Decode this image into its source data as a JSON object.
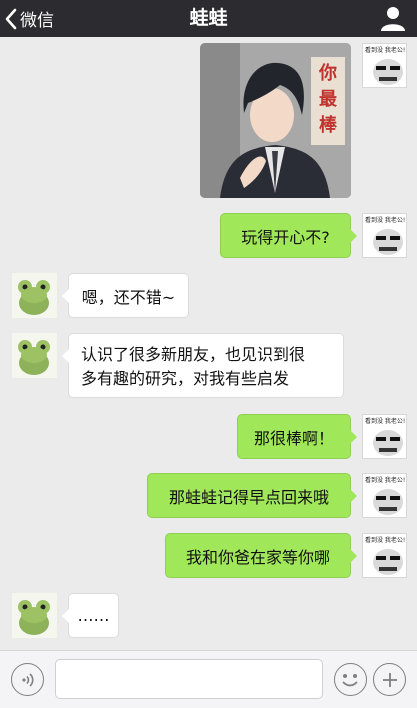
{
  "header": {
    "back_label": "微信",
    "title": "蛙蛙"
  },
  "me_avatar_caption": "看到没 我老公!",
  "image_message": {
    "sign_text": [
      "你",
      "最",
      "棒"
    ]
  },
  "messages": [
    {
      "from": "me",
      "text": "玩得开心不?"
    },
    {
      "from": "frog",
      "text": "嗯，还不错~"
    },
    {
      "from": "frog",
      "lines": [
        "认识了很多新朋友，也见识到很",
        "多有趣的研究，对我有些启发"
      ]
    },
    {
      "from": "me",
      "text": "那很棒啊！"
    },
    {
      "from": "me",
      "text": "那蛙蛙记得早点回来哦"
    },
    {
      "from": "me",
      "text": "我和你爸在家等你哪"
    },
    {
      "from": "frog",
      "text": "……"
    }
  ],
  "colors": {
    "nav_bg": "#2c2c30",
    "chat_bg": "#ebebeb",
    "my_bubble": "#a0e75a",
    "their_bubble": "#ffffff"
  },
  "icons": {
    "back": "chevron-left-icon",
    "profile": "person-icon",
    "voice": "voice-icon",
    "emoji": "smiley-icon",
    "more": "plus-icon"
  }
}
